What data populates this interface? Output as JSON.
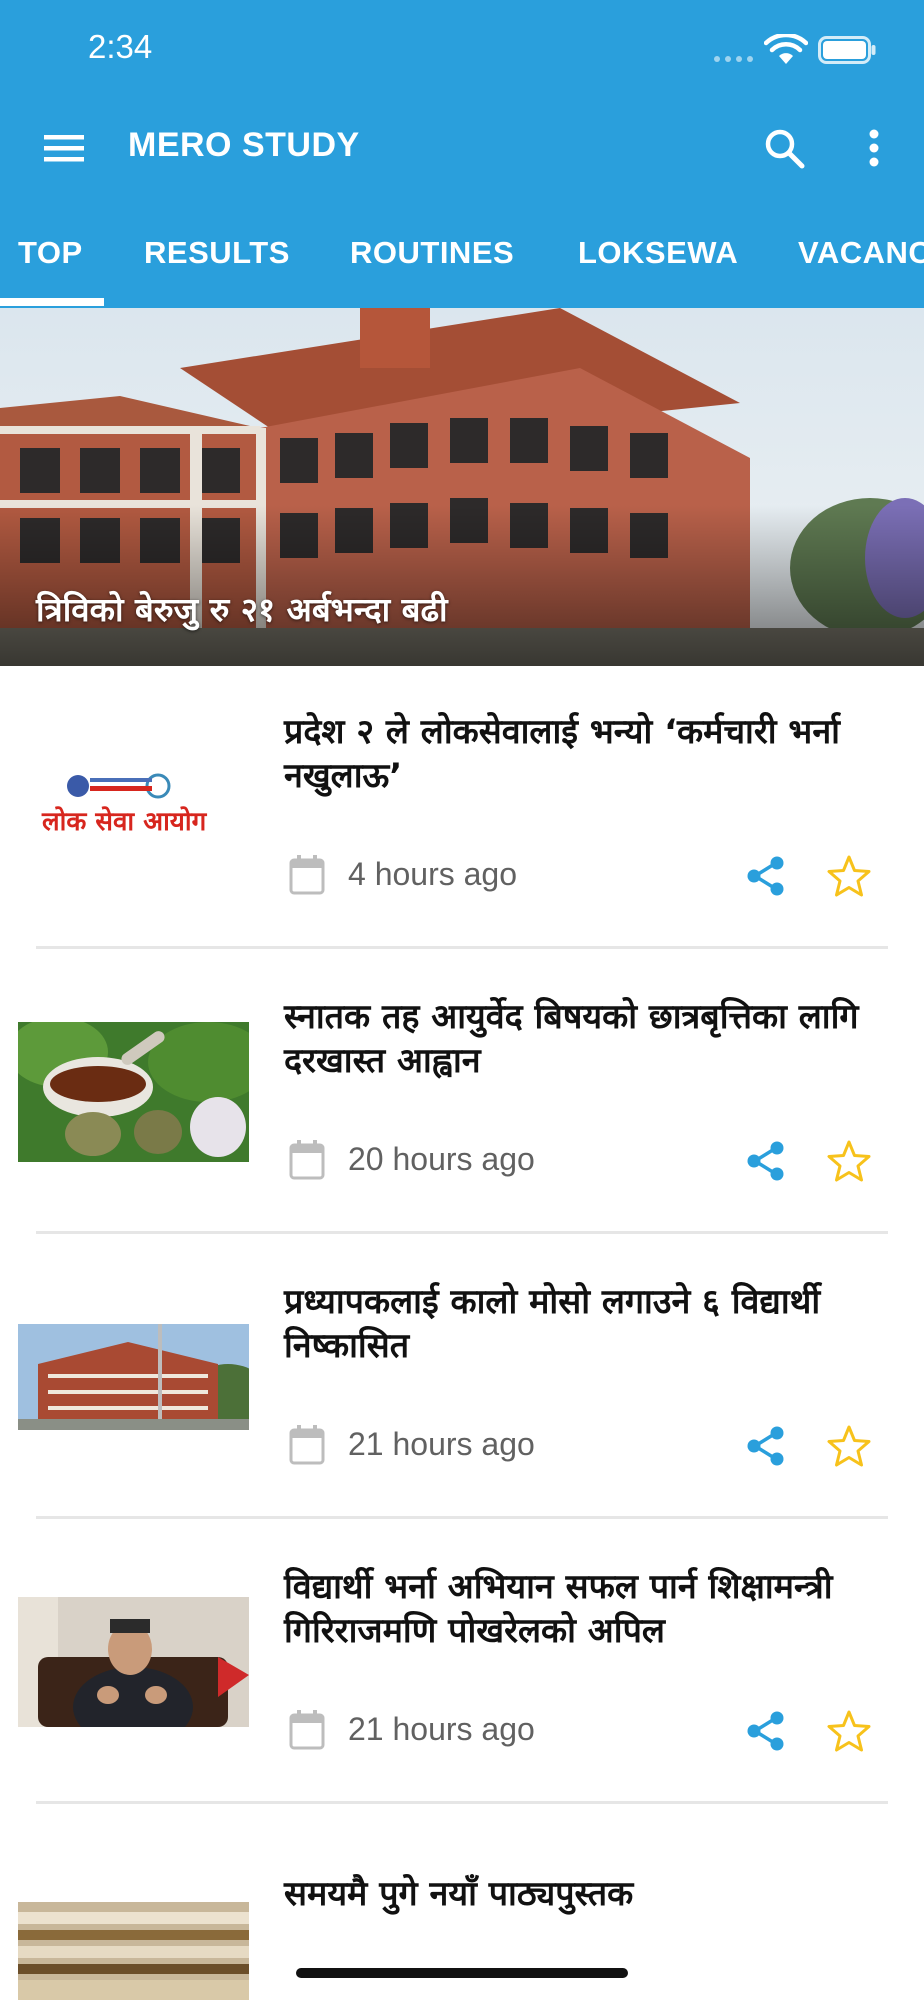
{
  "status_bar": {
    "time": "2:34"
  },
  "app": {
    "title": "MERO STUDY"
  },
  "tabs": [
    {
      "label": "TOP"
    },
    {
      "label": "RESULTS"
    },
    {
      "label": "ROUTINES"
    },
    {
      "label": "LOKSEWA"
    },
    {
      "label": "VACANC"
    }
  ],
  "featured": {
    "caption": "त्रिविको बेरुजु रु २१ अर्बभन्दा बढी"
  },
  "news": [
    {
      "headline": "प्रदेश २ ले लोकसेवालाई भन्यो ‘कर्मचारी भर्ना नखुलाऊ’",
      "time": "4 hours ago",
      "thumb_label": "लोक सेवा आयोग",
      "thumb_small": "लोक सेवा आयोग"
    },
    {
      "headline": "स्नातक तह आयुर्वेद बिषयको छात्रबृत्तिका लागि दरखास्त आह्वान",
      "time": "20 hours ago"
    },
    {
      "headline": "प्रध्यापकलाई कालो मोसो लगाउने ६ विद्यार्थी निष्कासित",
      "time": "21 hours ago"
    },
    {
      "headline": "विद्यार्थी भर्ना अभियान सफल पार्न शिक्षामन्त्री गिरिराजमणि पोखरेलको अपिल",
      "time": "21 hours ago"
    },
    {
      "headline": "समयमै पुगे नयाँ पाठ्यपुस्तक"
    }
  ],
  "colors": {
    "primary": "#2a9fdc",
    "share": "#2a9fdc",
    "star": "#f7c21b",
    "brand_red": "#d7261e"
  },
  "icons": [
    "menu-icon",
    "search-icon",
    "more-vert-icon",
    "calendar-icon",
    "share-icon",
    "star-outline-icon",
    "wifi-icon",
    "battery-icon"
  ]
}
